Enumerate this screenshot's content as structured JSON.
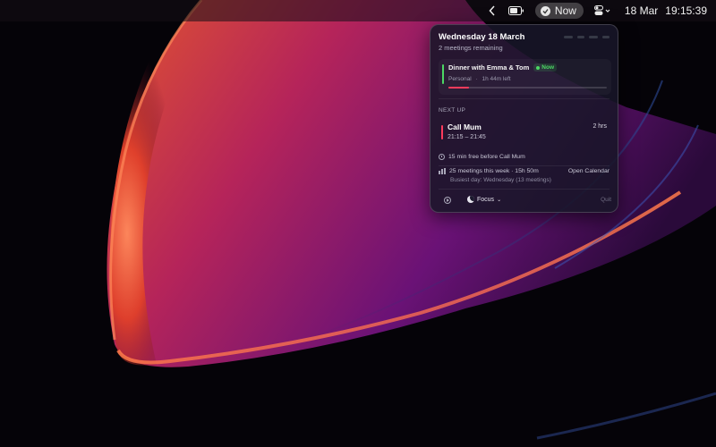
{
  "menubar": {
    "now_label": "Now",
    "date": "18 Mar",
    "time": "19:15:39",
    "icons": [
      "chevron-left-icon",
      "battery-icon",
      "calendar-check-icon",
      "control-center-icon"
    ]
  },
  "panel": {
    "date_title": "Wednesday 18 March",
    "meetings_remaining": "2 meetings remaining",
    "current": {
      "title": "Dinner with Emma & Tom",
      "badge": "Now",
      "calendar": "Personal",
      "separator": "·",
      "time_left": "1h 44m left",
      "progress": 0.13,
      "color": "#4cd964"
    },
    "next_label": "NEXT UP",
    "next": {
      "title": "Call Mum",
      "time": "21:15 – 21:45",
      "duration": "2 hrs",
      "color": "#ff3b5c"
    },
    "free_time": "15 min free before Call Mum",
    "stats": "25 meetings this week · 15h 50m",
    "open_calendar": "Open Calendar",
    "busiest": "Busiest day: Wednesday (13 meetings)",
    "focus_label": "Focus",
    "quit_label": "Quit"
  },
  "colors": {
    "accent_green": "#4cd964",
    "accent_red": "#ff3b5c"
  }
}
